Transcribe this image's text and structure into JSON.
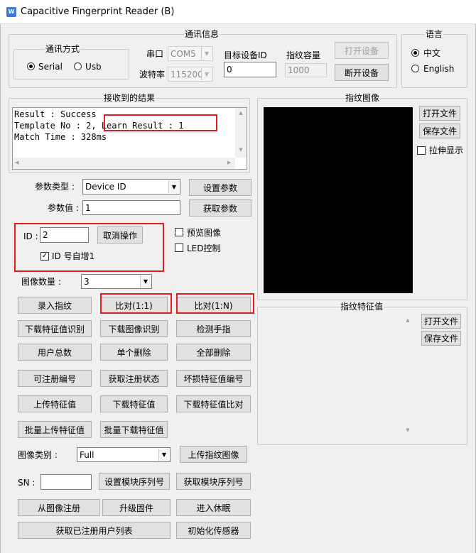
{
  "window": {
    "title": "Capacitive Fingerprint Reader (B)",
    "icon": "app-icon"
  },
  "comm": {
    "group_title": "通讯信息",
    "mode_group_title": "通讯方式",
    "serial_label": "Serial",
    "usb_label": "Usb",
    "serial_checked": true,
    "port_label": "串口",
    "port_value": "COM5",
    "baud_label": "波特率",
    "baud_value": "115200",
    "target_id_label": "目标设备ID",
    "target_id_value": "0",
    "capacity_label": "指纹容量",
    "capacity_value": "1000",
    "open_button": "打开设备",
    "close_button": "断开设备"
  },
  "language": {
    "group_title": "语言",
    "chinese_label": "中文",
    "english_label": "English",
    "chinese_checked": true
  },
  "result": {
    "group_title": "接收到的结果",
    "lines": [
      "Result : Success",
      "Template No : 2, Learn Result : 1",
      "Match Time : 328ms"
    ]
  },
  "params": {
    "type_label": "参数类型 :",
    "type_value": "Device ID",
    "value_label": "参数值 :",
    "value_value": "1",
    "set_button": "设置参数",
    "get_button": "获取参数"
  },
  "id_section": {
    "id_label": "ID :",
    "id_value": "2",
    "cancel_button": "取消操作",
    "auto_inc_label": "ID 号自增1",
    "auto_inc_checked": true,
    "preview_label": "预览图像",
    "preview_checked": false,
    "led_label": "LED控制",
    "led_checked": false
  },
  "image_count": {
    "label": "图像数量 :",
    "value": "3"
  },
  "buttons": {
    "enroll": "录入指纹",
    "match_1_1": "比对(1:1)",
    "match_1_n": "比对(1:N)",
    "download_feature_identify": "下载特征值识别",
    "download_image_identify": "下载图像识别",
    "detect_finger": "检测手指",
    "user_total": "用户总数",
    "delete_single": "单个删除",
    "delete_all": "全部删除",
    "enrollable_id": "可注册编号",
    "get_enroll_status": "获取注册状态",
    "bad_feature_id": "坏损特征值编号",
    "upload_feature": "上传特征值",
    "download_feature": "下载特征值",
    "download_feature_compare": "下载特征值比对",
    "batch_upload_feature": "批量上传特征值",
    "batch_download_feature": "批量下载特征值",
    "upload_image": "上传指纹图像",
    "set_sn": "设置模块序列号",
    "get_sn": "获取模块序列号",
    "enroll_from_image": "从图像注册",
    "upgrade_firmware": "升级固件",
    "enter_sleep": "进入休眠",
    "get_enrolled_list": "获取已注册用户列表",
    "init_sensor": "初始化传感器"
  },
  "image_type": {
    "label": "图像类别 :",
    "value": "Full"
  },
  "sn": {
    "label": "SN :",
    "value": ""
  },
  "fingerprint_image": {
    "group_title": "指纹图像",
    "open_file": "打开文件",
    "save_file": "保存文件",
    "stretch_label": "拉伸显示",
    "stretch_checked": false
  },
  "feature": {
    "group_title": "指纹特征值",
    "open_file": "打开文件",
    "save_file": "保存文件"
  },
  "colors": {
    "highlight_red": "#e02020",
    "image_bg": "#000000"
  }
}
